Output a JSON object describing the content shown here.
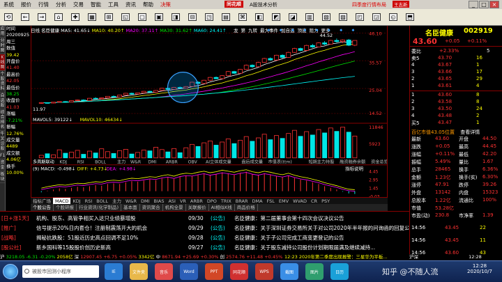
{
  "menubar": {
    "items": [
      "系统",
      "报价",
      "行情",
      "分析",
      "交易",
      "智能",
      "工具",
      "资讯",
      "帮助",
      "决策"
    ],
    "brand": "同花顺",
    "title": "A股技术分析",
    "right_ad": "四季度行情布局",
    "user": "王志新",
    "icons": [
      "日线",
      "分时",
      "设置",
      "返回",
      "前进"
    ],
    "btns": [
      "_",
      "□",
      "×"
    ]
  },
  "toolbar": {
    "buttons": [
      {
        "i": "⟲",
        "t": ""
      },
      {
        "i": "←",
        "t": ""
      },
      {
        "i": "→",
        "t": ""
      },
      {
        "i": "⌂",
        "t": ""
      },
      {
        "i": "✚",
        "t": ""
      },
      {
        "i": "▦",
        "t": ""
      },
      {
        "i": "⊞",
        "t": ""
      },
      {
        "i": "◱",
        "t": ""
      },
      {
        "i": "▢",
        "t": ""
      },
      {
        "i": "▣",
        "t": ""
      },
      {
        "i": "◨",
        "t": ""
      },
      {
        "i": "⊟",
        "t": ""
      },
      {
        "i": "◳",
        "t": ""
      },
      {
        "i": "▤",
        "t": ""
      },
      {
        "i": "⌘",
        "t": ""
      },
      {
        "i": "◧",
        "t": ""
      },
      {
        "i": "◩",
        "t": ""
      },
      {
        "i": "◪",
        "t": ""
      },
      {
        "i": "▥",
        "t": ""
      },
      {
        "i": "▧",
        "t": ""
      },
      {
        "i": "▨",
        "t": ""
      },
      {
        "i": "◰",
        "t": ""
      },
      {
        "i": "◲",
        "t": ""
      },
      {
        "i": "◵",
        "t": ""
      },
      {
        "i": "⬒",
        "t": ""
      }
    ]
  },
  "lside": [
    "应用",
    "分时图",
    "K线图",
    "个股资料",
    "自选股",
    "综合排名",
    "牛叉诊股",
    "F10",
    "资金",
    "板块"
  ],
  "info": [
    {
      "t": "时间",
      "c": "wh"
    },
    {
      "t": "20200925",
      "c": "wh"
    },
    {
      "t": "周三",
      "c": "wh"
    },
    {
      "t": "数值",
      "c": "wh"
    },
    {
      "t": "39.42",
      "c": "yl"
    },
    {
      "t": "开盘价",
      "c": "wh"
    },
    {
      "t": "41.40",
      "c": "rd"
    },
    {
      "t": "最高价",
      "c": "wh"
    },
    {
      "t": "42.05",
      "c": "rd"
    },
    {
      "t": "最低价",
      "c": "wh"
    },
    {
      "t": "38.25",
      "c": "gr"
    },
    {
      "t": "收盘价",
      "c": "wh"
    },
    {
      "t": "41.03",
      "c": "rd"
    },
    {
      "t": "涨幅",
      "c": "wh"
    },
    {
      "t": "-7.21%",
      "c": "gr"
    },
    {
      "t": "振幅",
      "c": "wh"
    },
    {
      "t": "12.76%",
      "c": "yl"
    },
    {
      "t": "成交量",
      "c": "wh"
    },
    {
      "t": "4489",
      "c": "yl"
    },
    {
      "t": "成交额",
      "c": "wh"
    },
    {
      "t": "4.06亿",
      "c": "yl"
    },
    {
      "t": "换手",
      "c": "wh"
    },
    {
      "t": "10.00%",
      "c": "yl"
    }
  ],
  "legend": {
    "daily": "日线",
    "name": "名臣健康",
    "ma5": "MA5: 41.65↓",
    "ma10": "MA10: 40.20↑",
    "ma20": "MA20: 37.11↑",
    "ma30": "MA30: 31.62↑",
    "ma60": "MA60: 24.41↑"
  },
  "chart_tabs": [
    "龙",
    "第",
    "九转",
    "最大事件",
    "加自选",
    "顶底",
    "阻力",
    "更多"
  ],
  "y_axis": [
    "46.10",
    "35.57",
    "25.04",
    "14.52"
  ],
  "price_labels": {
    "high": "44.52",
    "low": "11.97"
  },
  "vol_legend": {
    "a": "MAVOL5: 39122↓",
    "b": "MAVOL10: 46434↓"
  },
  "vol_axis": [
    "11846",
    "5923"
  ],
  "func_tabs": [
    "多周期联动",
    "KDJ",
    "RSI",
    "BOLL",
    "主力",
    "W&R",
    "DMI",
    "ARBR",
    "OBV",
    "AI立体成交量",
    "盘后成交量",
    "市值表(ttm)",
    "短期主力持股",
    "融资融券余额",
    "资金总览"
  ],
  "macd_legend": {
    "a": "(9) MACD: -0.498↓",
    "b": "DIFF: +4.73↓",
    "c": "DEA: +4.98↓",
    "right": "指标说明"
  },
  "macd_axis": [
    "4.45",
    "2.95",
    "1.45",
    "-0.03"
  ],
  "date_marks": [
    "8",
    "9"
  ],
  "tabs1": [
    "指标广场",
    "MACD",
    "KDJ",
    "RSI",
    "BOLL",
    "主力",
    "W&R",
    "DMI",
    "BIAS",
    "ASI",
    "VR",
    "ARBR",
    "DPO",
    "TRIX",
    "BRAR",
    "DMA",
    "FSL",
    "EMV",
    "WVAD",
    "CR",
    "PSY"
  ],
  "tabs2": [
    "个股公告",
    "个股研报",
    "行业资讯(化学制品)",
    "基本面",
    "资讯聚合",
    "机构全景",
    "关联报价",
    "AI相似K线",
    "商品价格"
  ],
  "news": [
    {
      "tag": "[日+涨1天]",
      "title": "机构、股东、高管争相买入这只业绩暴增股",
      "time": "09/30",
      "src": "(公告)",
      "nt": "名臣健康：第二届董事会第十四次会议决议公告"
    },
    {
      "tag": "[推广]",
      "title": "信号提示20%日内套仓！注册制震荡开大的机会",
      "time": "09/29",
      "src": "(公告)",
      "nt": "名臣健康：关于深圳证券交易所关于对公司2020年半年报的问询函的回复公告"
    },
    {
      "tag": "[战略]",
      "title": "揭秘抗跌股：51股近历史高点回调不足10%",
      "time": "09/28",
      "src": "(公告)",
      "nt": "名臣健康：关于子公司完成工商变更登记的公告"
    },
    {
      "tag": "[股公社]",
      "title": "新乡国科等15股股价创历史新高",
      "time": "09/27",
      "src": "(公告)",
      "nt": "名臣健康：关于股东减持公司股份计划期限届满及继续减持..."
    }
  ],
  "status_bar": {
    "a": "沪",
    "av": "3218.05",
    "ac": "-6.31",
    "ap": "-0.20%",
    "av2": "2058亿",
    "b": "深",
    "bv": "12907.45",
    "bc": "+6.75",
    "bp": "+0.05%",
    "bv2": "3342亿",
    "c": "中",
    "cv": "8671.94",
    "cc": "+25.69",
    "cp": "+0.30%",
    "d": "创",
    "dv": "2574.76",
    "dc": "+11.48",
    "dp": "+0.45%",
    "time": "12:23",
    "msg": "2020年第二季度出现报警：三星华为平板..."
  },
  "quote": {
    "title": "名臣健康",
    "code": "002919",
    "price": "43.60",
    "change": "+0.05",
    "pct": "+0.11%",
    "ratio_label": "委比",
    "ratio": "+2.33%",
    "ratio2": "5",
    "ask": [
      {
        "l": "卖5",
        "p": "43.70",
        "v": "16"
      },
      {
        "l": "4",
        "p": "43.67",
        "v": "1"
      },
      {
        "l": "3",
        "p": "43.66",
        "v": "17"
      },
      {
        "l": "2",
        "p": "43.65",
        "v": "29"
      },
      {
        "l": "1",
        "p": "43.61",
        "v": "4"
      }
    ],
    "bid": [
      {
        "l": "1",
        "p": "43.60",
        "v": "8"
      },
      {
        "l": "2",
        "p": "43.58",
        "v": "8"
      },
      {
        "l": "3",
        "p": "43.50",
        "v": "24"
      },
      {
        "l": "4",
        "p": "43.48",
        "v": "2"
      },
      {
        "l": "买5",
        "p": "43.47",
        "v": "1"
      }
    ],
    "tags": [
      "百亿市值43.05位置",
      "查看详情"
    ],
    "stats": [
      {
        "k": "最新",
        "v": "43.60",
        "k2": "开盘",
        "v2": "44.50"
      },
      {
        "k": "涨跌",
        "v": "+0.05",
        "k2": "最高",
        "v2": "44.45"
      },
      {
        "k": "涨幅",
        "v": "+0.11%",
        "k2": "最低",
        "v2": "42.20"
      },
      {
        "k": "振幅",
        "v": "5.49%",
        "k2": "量比",
        "v2": "1.67"
      },
      {
        "k": "总手",
        "v": "28465",
        "k2": "换手",
        "v2": "6.36%"
      },
      {
        "k": "金额",
        "v": "1.23亿",
        "k2": "换手(实)",
        "v2": "6.30%"
      },
      {
        "k": "涨停",
        "v": "47.91",
        "k2": "跌停",
        "v2": "39.26"
      },
      {
        "k": "外盘",
        "v": "13142",
        "k2": "内盘",
        "v2": "15323"
      },
      {
        "k": "总股本",
        "v": "1.22亿",
        "k2": "流通比",
        "v2": "100%"
      },
      {
        "k": "市值",
        "v": "53.28亿",
        "k2": "",
        "v2": ""
      },
      {
        "k": "市盈(动)",
        "v": "230.8",
        "k2": "市净率",
        "v2": "1.39"
      }
    ],
    "ticks": [
      {
        "t": "14:56",
        "p": "43.45",
        "v": "22"
      },
      {
        "t": "14:56",
        "p": "43.45",
        "v": "11"
      },
      {
        "t": "14:56",
        "p": "43.60",
        "v": "43"
      },
      {
        "t": "14:57",
        "p": "43.60",
        "v": "4"
      }
    ],
    "right_status": [
      "沪深",
      "12:28"
    ]
  },
  "taskbar": {
    "search": "被股市回测小程序",
    "items": [
      "IE",
      "文件夹",
      "音乐",
      "Word",
      "PPT",
      "同花顺",
      "WPS",
      "截图",
      "图片",
      "日历"
    ],
    "time": "12:28",
    "date": "2020/10/7",
    "watermark": "知乎 @不随人流"
  },
  "chart_data": {
    "type": "candlestick",
    "candles": [
      [
        14.8,
        15.2,
        14.5,
        15.0
      ],
      [
        15.0,
        15.1,
        14.6,
        14.8
      ],
      [
        14.8,
        15.3,
        14.6,
        15.2
      ],
      [
        15.2,
        15.6,
        15.0,
        15.5
      ],
      [
        15.5,
        15.7,
        15.1,
        15.3
      ],
      [
        15.3,
        16.0,
        15.2,
        15.9
      ],
      [
        15.9,
        16.4,
        15.7,
        16.2
      ],
      [
        16.2,
        16.5,
        15.8,
        16.0
      ],
      [
        16.0,
        17.1,
        15.9,
        17.0
      ],
      [
        17.0,
        17.5,
        16.6,
        16.8
      ],
      [
        16.8,
        17.3,
        16.5,
        17.2
      ],
      [
        17.2,
        18.0,
        17.0,
        17.9
      ],
      [
        17.9,
        18.3,
        17.4,
        17.6
      ],
      [
        17.6,
        18.6,
        17.5,
        18.5
      ],
      [
        18.5,
        19.5,
        18.3,
        19.3
      ],
      [
        19.3,
        19.6,
        18.7,
        18.9
      ],
      [
        18.9,
        19.6,
        18.8,
        19.5
      ],
      [
        19.5,
        20.4,
        19.3,
        20.2
      ],
      [
        20.2,
        20.5,
        19.6,
        19.8
      ],
      [
        19.8,
        20.8,
        19.7,
        20.6
      ],
      [
        20.6,
        21.8,
        20.4,
        21.6
      ],
      [
        21.6,
        21.9,
        20.9,
        21.1
      ],
      [
        21.1,
        22.2,
        21.0,
        22.0
      ],
      [
        22.0,
        22.4,
        21.4,
        21.7
      ],
      [
        21.7,
        22.6,
        21.5,
        22.4
      ],
      [
        22.4,
        24.6,
        22.2,
        24.4
      ],
      [
        24.4,
        24.8,
        23.6,
        23.8
      ],
      [
        23.8,
        25.5,
        23.6,
        25.3
      ],
      [
        25.3,
        26.8,
        25.0,
        26.6
      ],
      [
        26.6,
        27.0,
        25.8,
        26.0
      ],
      [
        26.0,
        27.6,
        25.8,
        27.4
      ],
      [
        27.4,
        29.5,
        27.2,
        29.3
      ],
      [
        29.3,
        29.6,
        28.2,
        28.5
      ],
      [
        28.5,
        30.5,
        28.3,
        30.3
      ],
      [
        30.3,
        32.5,
        30.1,
        32.2
      ],
      [
        32.2,
        32.6,
        31.0,
        31.5
      ],
      [
        31.5,
        33.8,
        31.3,
        33.5
      ],
      [
        33.5,
        35.6,
        33.3,
        35.3
      ],
      [
        35.3,
        35.8,
        34.2,
        34.6
      ],
      [
        34.6,
        37.0,
        34.4,
        36.8
      ],
      [
        36.8,
        37.2,
        35.4,
        35.8
      ],
      [
        35.8,
        38.4,
        35.6,
        38.1
      ],
      [
        38.1,
        40.2,
        37.9,
        39.9
      ],
      [
        39.9,
        40.3,
        38.6,
        39.0
      ],
      [
        39.0,
        41.6,
        38.8,
        41.3
      ],
      [
        41.3,
        42.0,
        40.2,
        40.6
      ],
      [
        40.6,
        42.8,
        40.4,
        42.5
      ],
      [
        42.5,
        43.3,
        41.4,
        41.9
      ],
      [
        41.9,
        43.9,
        41.7,
        43.6
      ],
      [
        43.6,
        44.5,
        42.6,
        43.1
      ],
      [
        43.1,
        44.1,
        42.4,
        43.8
      ],
      [
        43.8,
        44.3,
        41.0,
        41.4
      ],
      [
        41.4,
        43.4,
        41.0,
        43.6
      ]
    ],
    "volumes": [
      1.0,
      1.6,
      1.2,
      3.1,
      1.8,
      2.2,
      2.9,
      1.4,
      2.6,
      1.9,
      3.5,
      2.4,
      1.7,
      2.8,
      3.3,
      1.5,
      2.1,
      3.0,
      2.7,
      4.1,
      3.2,
      2.3,
      3.6,
      2.0,
      3.9,
      5.2,
      4.4,
      5.8,
      6.5,
      4.9,
      6.1,
      7.3,
      5.5,
      6.8,
      8.2,
      6.4,
      7.7,
      9.1,
      7.0,
      8.6,
      7.5,
      9.4,
      10.6,
      8.3,
      10.1,
      8.8,
      10.9,
      9.6,
      11.5,
      10.2,
      11.8,
      9.9,
      8.4
    ],
    "macd": [
      -0.2,
      0.1,
      0.3,
      0.5,
      0.4,
      0.6,
      0.8,
      0.7,
      0.9,
      1.1,
      1.0,
      1.3,
      1.4,
      1.3,
      1.6,
      1.8,
      1.7,
      1.9,
      2.1,
      2.0,
      2.3,
      2.5,
      2.2,
      2.6,
      2.8,
      2.7,
      3.0,
      3.2,
      2.9,
      3.1,
      3.4,
      3.2,
      3.0,
      3.3,
      3.5,
      3.1,
      2.9,
      3.2,
      3.0,
      2.7,
      2.5,
      2.8,
      2.4,
      2.1,
      1.9,
      1.6,
      1.3,
      0.9,
      0.6,
      0.3,
      -0.1,
      -0.4,
      -0.5
    ],
    "ylim": [
      10,
      47
    ]
  }
}
